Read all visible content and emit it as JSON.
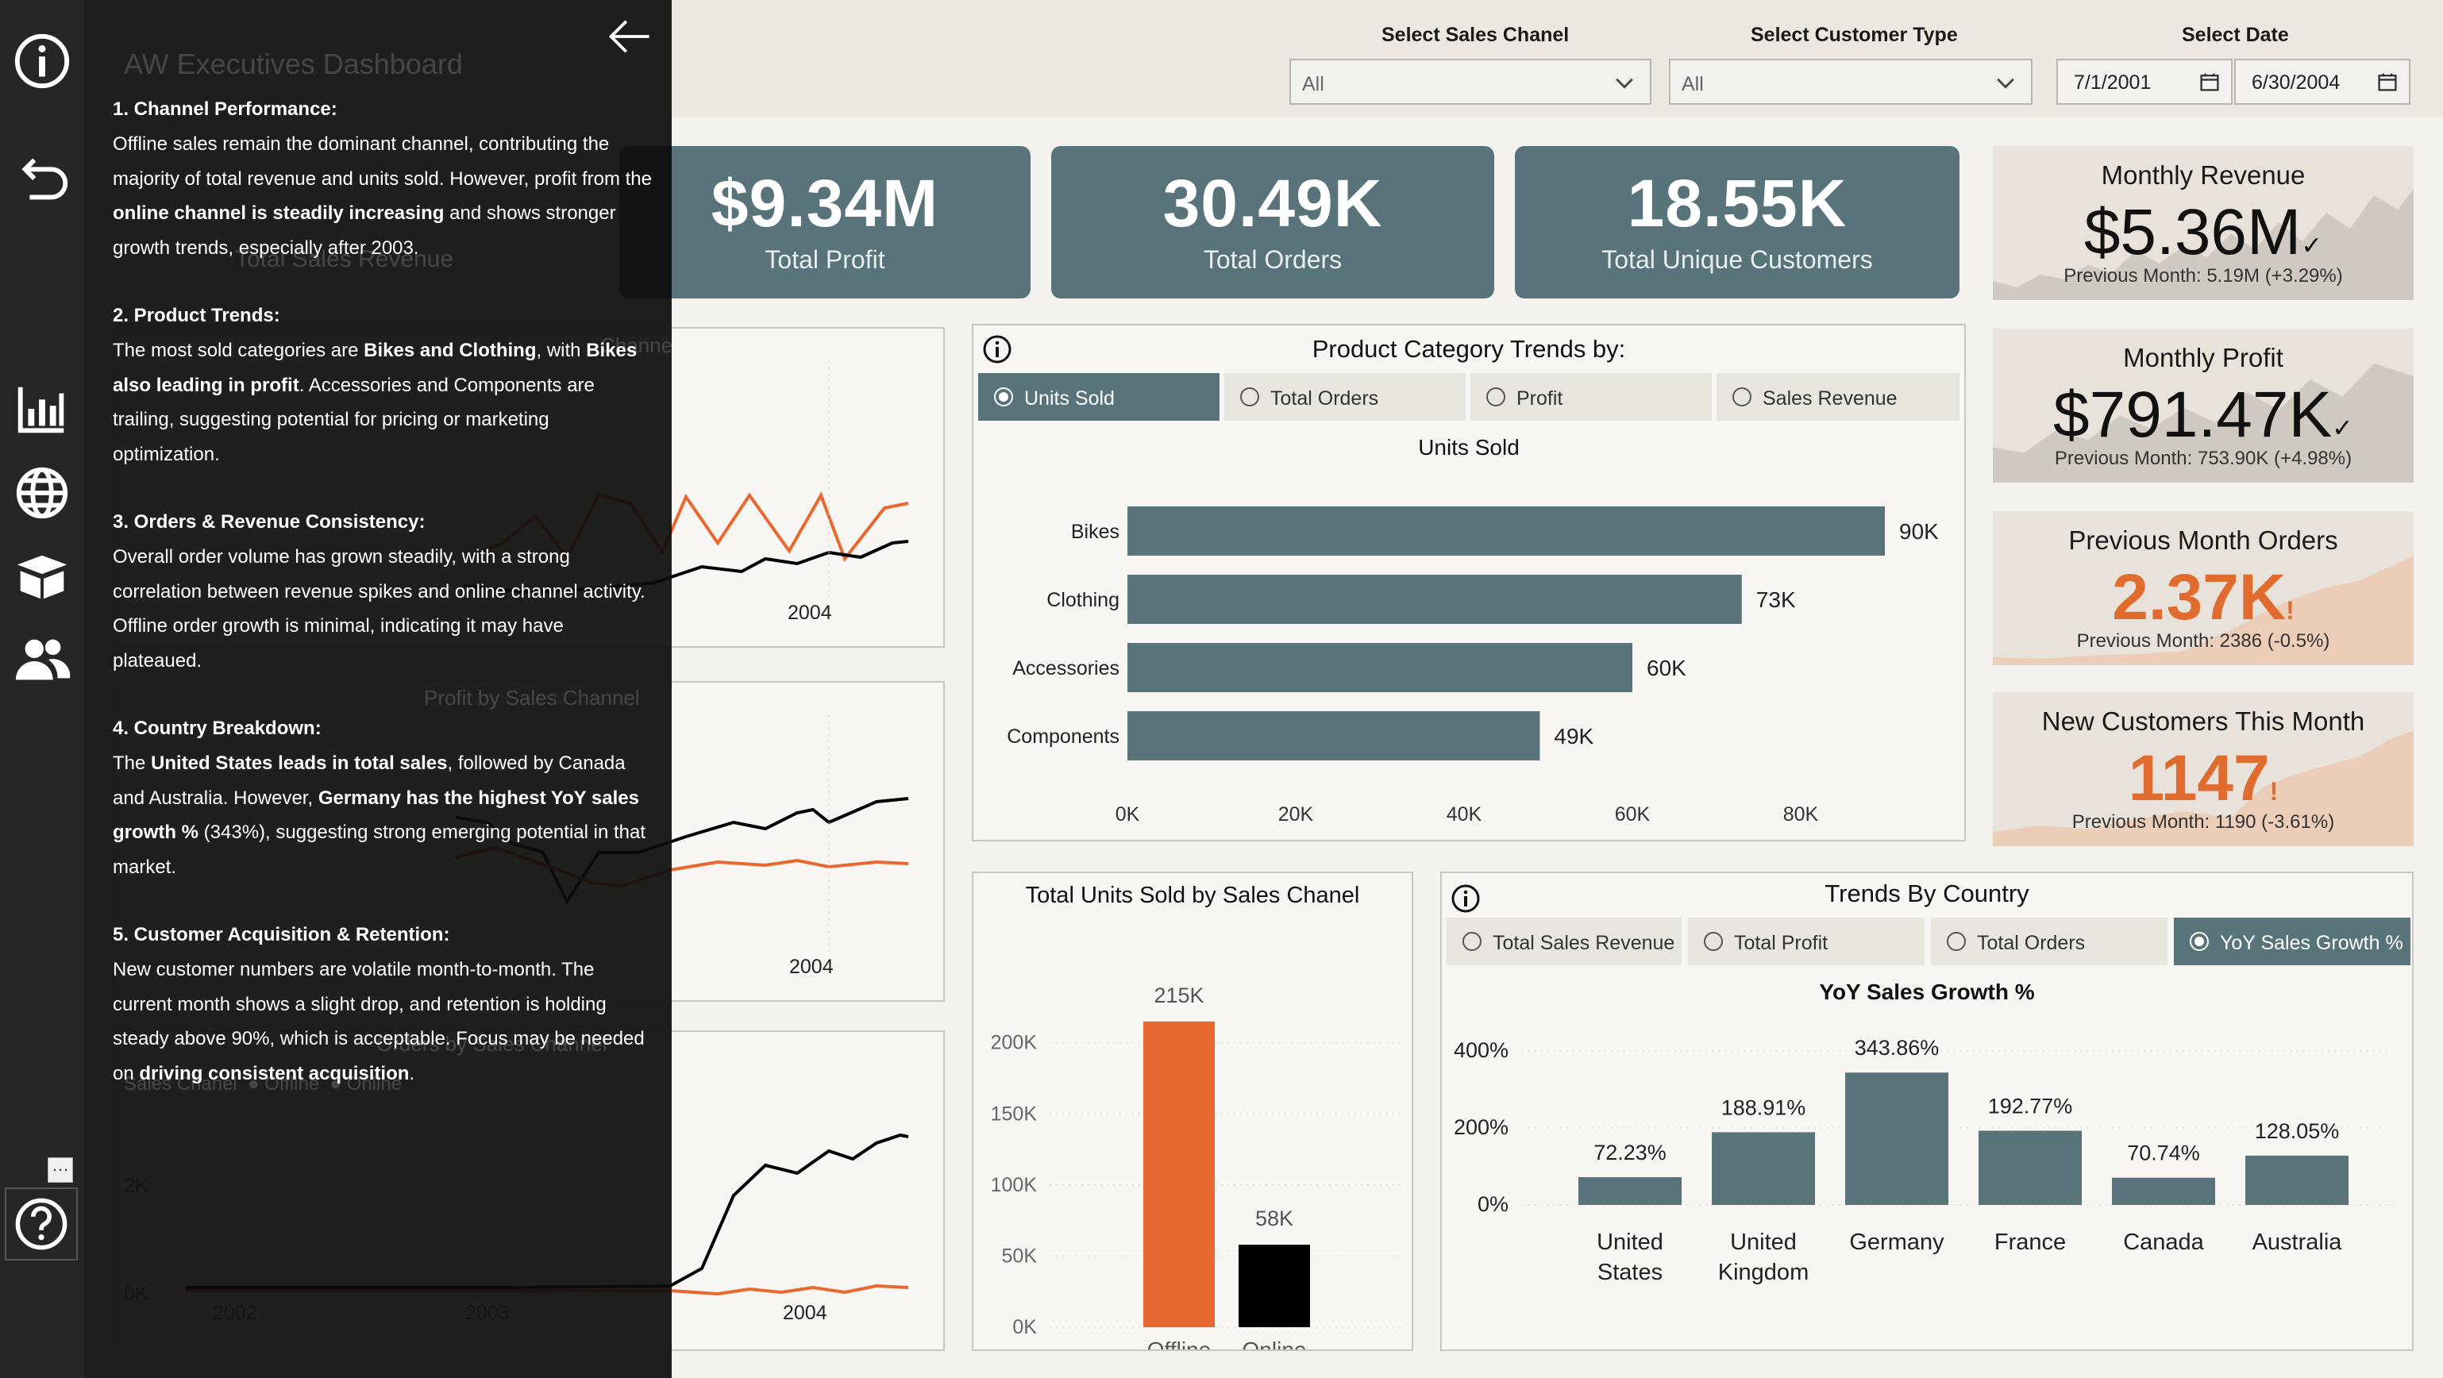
{
  "header": {
    "sales_channel_label": "Select Sales Chanel",
    "sales_channel_value": "All",
    "customer_type_label": "Select Customer Type",
    "customer_type_value": "All",
    "date_label": "Select Date",
    "date_start": "7/1/2001",
    "date_end": "6/30/2004"
  },
  "kpis": [
    {
      "value": "$9.34M",
      "label": "Total Profit"
    },
    {
      "value": "30.49K",
      "label": "Total Orders"
    },
    {
      "value": "18.55K",
      "label": "Total Unique Customers"
    }
  ],
  "cards": [
    {
      "title": "Monthly Revenue",
      "value": "$5.36M",
      "mark": "✓",
      "sub": "Previous Month: 5.19M (+3.29%)"
    },
    {
      "title": "Monthly Profit",
      "value": "$791.47K",
      "mark": "✓",
      "sub": "Previous Month: 753.90K (+4.98%)"
    },
    {
      "title": "Previous Month Orders",
      "value": "2.37K",
      "mark": "!",
      "sub": "Previous Month: 2386 (-0.5%)"
    },
    {
      "title": "New Customers This Month",
      "value": "1147",
      "mark": "!",
      "sub": "Previous Month: 1190 (-3.61%)"
    }
  ],
  "product_panel": {
    "title": "Product Category Trends by:",
    "options": [
      "Units Sold",
      "Total Orders",
      "Profit",
      "Sales Revenue"
    ],
    "selected": 0,
    "chart_title": "Units Sold"
  },
  "channel_panel": {
    "title": "Total Units Sold by Sales Chanel"
  },
  "country_panel": {
    "title": "Trends By Country",
    "options": [
      "Total Sales Revenue",
      "Total Profit",
      "Total Orders",
      "YoY Sales Growth %"
    ],
    "selected": 3,
    "chart_title": "YoY Sales Growth %"
  },
  "line_charts": {
    "tick_2004": "2004",
    "bottom_ticks": [
      "2002",
      "2003",
      "2004"
    ],
    "bottom_y_ticks": [
      "2K",
      "0K"
    ],
    "ghost_title": "Profit by Sales Channel",
    "ghost_title_3": "Orders by Sales Channel",
    "ghost_legend_channel": "Sales Chanel",
    "ghost_legend_offline": "Offline",
    "ghost_legend_online": "Online"
  },
  "overlay": {
    "ghost_title": "AW Executives Dashboard",
    "ghost_card": "Total Sales Revenue",
    "ghost_chart": "Channel",
    "s1_title": "1. Channel Performance:",
    "s1_a": "Offline sales remain the dominant channel, contributing the majority of total revenue and units sold. However, profit from the ",
    "s1_b": "online channel is steadily increasing",
    "s1_c": " and shows stronger growth trends, especially after 2003.",
    "s2_title": "2. Product Trends:",
    "s2_a": "The most sold categories are ",
    "s2_b": "Bikes and Clothing",
    "s2_c": ", with ",
    "s2_d": "Bikes also leading in profit",
    "s2_e": ". Accessories and Components are trailing, suggesting potential for pricing or marketing optimization.",
    "s3_title": "3. Orders & Revenue Consistency:",
    "s3_a": "Overall order volume has grown steadily, with a strong correlation between revenue spikes and online channel activity. Offline order growth is minimal, indicating it may have plateaued.",
    "s4_title": "4. Country Breakdown:",
    "s4_a": "The ",
    "s4_b": "United States leads in total sales",
    "s4_c": ", followed by Canada and Australia. However, ",
    "s4_d": "Germany has the highest YoY sales growth %",
    "s4_e": " (343%), suggesting strong emerging potential in that market.",
    "s5_title": "5. Customer Acquisition & Retention:",
    "s5_a": "New customer numbers are volatile month-to-month. The current month shows a slight drop, and retention is holding steady above 90%, which is acceptable. Focus may be needed on ",
    "s5_b": "driving consistent acquisition",
    "s5_c": "."
  },
  "colors": {
    "teal": "#587379",
    "orange": "#e8682f",
    "black": "#000000",
    "nav": "#262626"
  },
  "icons": [
    "info-icon",
    "undo-icon",
    "bar-chart-icon",
    "globe-icon",
    "box-icon",
    "users-icon",
    "help-icon",
    "back-arrow-icon"
  ],
  "chart_data": [
    {
      "type": "bar",
      "orientation": "horizontal",
      "title": "Units Sold",
      "categories": [
        "Bikes",
        "Clothing",
        "Accessories",
        "Components"
      ],
      "values": [
        90000,
        73000,
        60000,
        49000
      ],
      "labels": [
        "90K",
        "73K",
        "60K",
        "49K"
      ],
      "xlim": [
        0,
        90000
      ],
      "xticks": [
        "0K",
        "20K",
        "40K",
        "60K",
        "80K"
      ]
    },
    {
      "type": "bar",
      "title": "Total Units Sold by Sales Chanel",
      "categories": [
        "Offline",
        "Online"
      ],
      "values": [
        215000,
        58000
      ],
      "labels": [
        "215K",
        "58K"
      ],
      "ylim": [
        0,
        230000
      ],
      "yticks": [
        "0K",
        "50K",
        "100K",
        "150K",
        "200K"
      ]
    },
    {
      "type": "bar",
      "title": "YoY Sales Growth %",
      "categories": [
        "United States",
        "United Kingdom",
        "Germany",
        "France",
        "Canada",
        "Australia"
      ],
      "values": [
        72.23,
        188.91,
        343.86,
        192.77,
        70.74,
        128.05
      ],
      "labels": [
        "72.23%",
        "188.91%",
        "343.86%",
        "192.77%",
        "70.74%",
        "128.05%"
      ],
      "ylim": [
        0,
        420
      ],
      "yticks": [
        "0%",
        "200%",
        "400%"
      ]
    }
  ]
}
